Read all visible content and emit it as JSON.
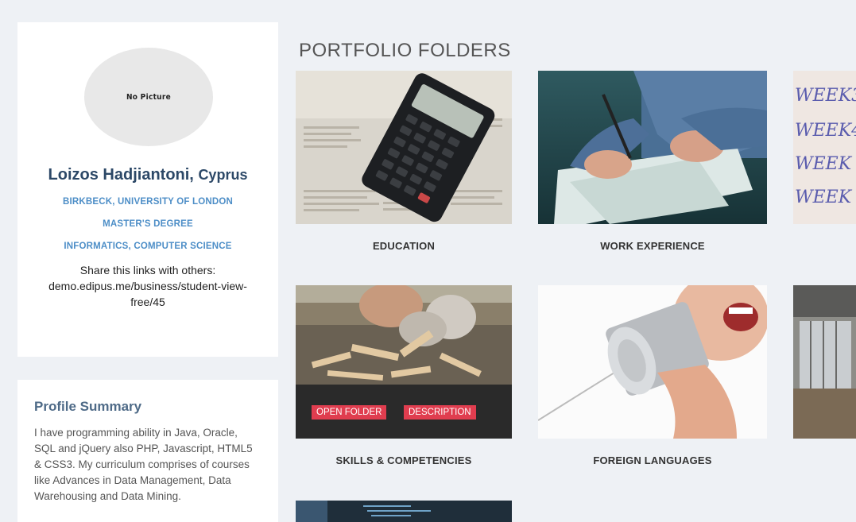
{
  "profile": {
    "avatar_text": "No Picture",
    "name": "Loizos Hadjiantoni,",
    "country": "Cyprus",
    "university": "BIRKBECK, UNIVERSITY OF LONDON",
    "degree": "MASTER'S DEGREE",
    "field": "INFORMATICS, COMPUTER SCIENCE",
    "share_text": "Share this links with others:",
    "share_link": "demo.edipus.me/business/student-view-free/45"
  },
  "summary": {
    "title": "Profile Summary",
    "text": "I have programming ability in Java, Oracle, SQL and jQuery also PHP, Javascript, HTML5 & CSS3. My curriculum comprises of courses like Advances in Data Management, Data Warehousing and Data Mining."
  },
  "portfolio": {
    "title": "PORTFOLIO FOLDERS",
    "folders": [
      {
        "label": "EDUCATION",
        "image": "calculator-photo"
      },
      {
        "label": "WORK EXPERIENCE",
        "image": "writing-hands-photo"
      },
      {
        "label": "",
        "image": "weekly-notes-photo"
      },
      {
        "label": "SKILLS & COMPETENCIES",
        "image": "woodworking-photo"
      },
      {
        "label": "FOREIGN LANGUAGES",
        "image": "tin-can-phone-photo"
      },
      {
        "label": "",
        "image": "office-room-photo"
      },
      {
        "label": "",
        "image": "code-screen-photo"
      }
    ],
    "open_folder_label": "OPEN FOLDER",
    "description_label": "DESCRIPTION"
  },
  "colors": {
    "background": "#eef1f5",
    "name": "#2c4867",
    "accent_link": "#4d8ec7",
    "button_red": "#e03d4f"
  }
}
